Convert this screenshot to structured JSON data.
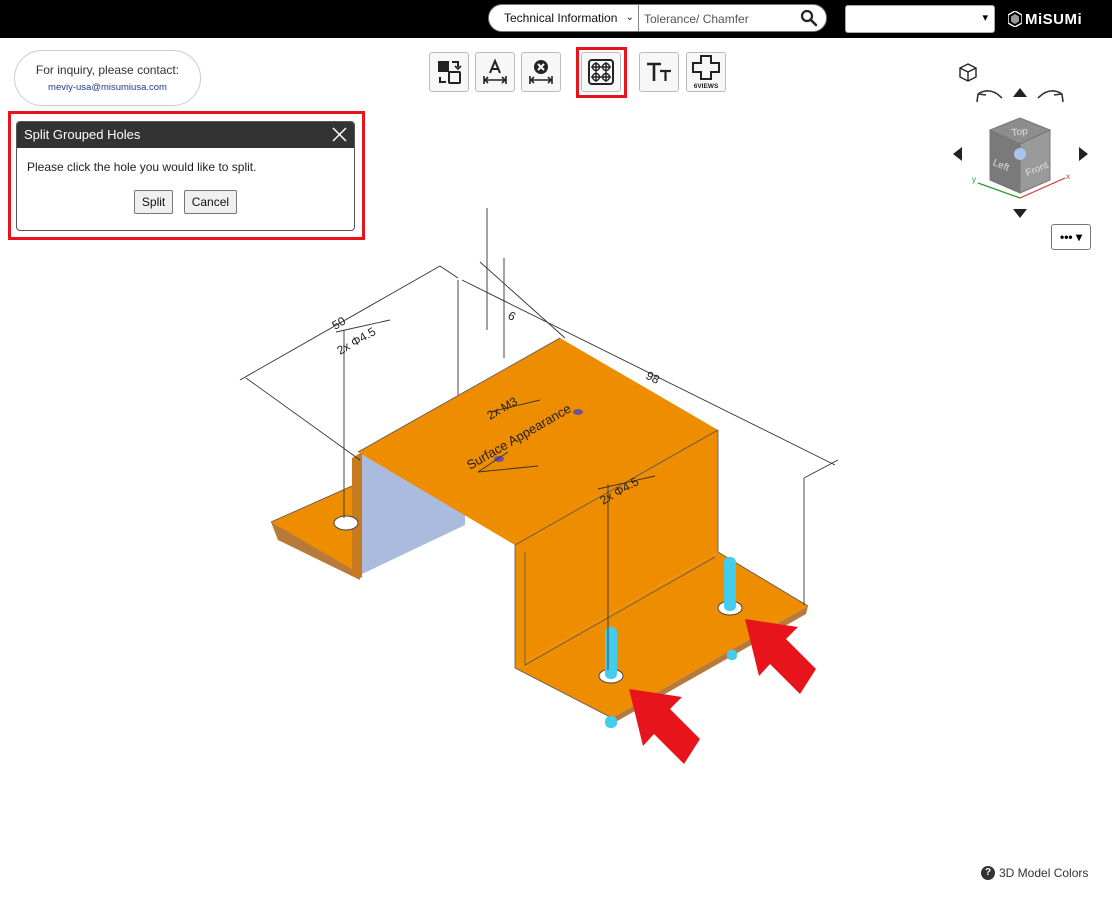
{
  "header": {
    "search_category": "Technical Information",
    "search_placeholder": "Tolerance/ Chamfer",
    "region_value": "",
    "logo_text": "MiSUMi"
  },
  "inquiry": {
    "line1": "For inquiry, please contact:",
    "email": "meviy-usa@misumiusa.com"
  },
  "toolbar": {
    "tools": [
      {
        "icon": "swap-shape-icon"
      },
      {
        "icon": "dimension-text-icon"
      },
      {
        "icon": "delete-dimension-icon"
      },
      {
        "icon": "split-holes-icon",
        "active": true
      },
      {
        "icon": "text-size-icon"
      },
      {
        "icon": "six-views-icon",
        "label": "6VIEWS"
      }
    ]
  },
  "dialog": {
    "title": "Split Grouped Holes",
    "message": "Please click the hole you would like to split.",
    "split_label": "Split",
    "cancel_label": "Cancel"
  },
  "viewcube": {
    "faces": {
      "top": "Top",
      "left": "Left",
      "front": "Front"
    }
  },
  "more_label": "••• ▾",
  "model": {
    "colors": {
      "body": "#ee8d00",
      "side": "#aabbdd",
      "pin": "#44ccee",
      "arrow": "#e8141b"
    },
    "annotations": {
      "dim_50": "50",
      "dim_98": "98",
      "dim_6": "6",
      "hole_top_left": "2x Φ4.5",
      "hole_right": "2x Φ4.5",
      "thread": "2x M3",
      "surface": "Surface Appearance"
    }
  },
  "footer": {
    "colors_label": "3D Model Colors",
    "help_glyph": "?"
  }
}
